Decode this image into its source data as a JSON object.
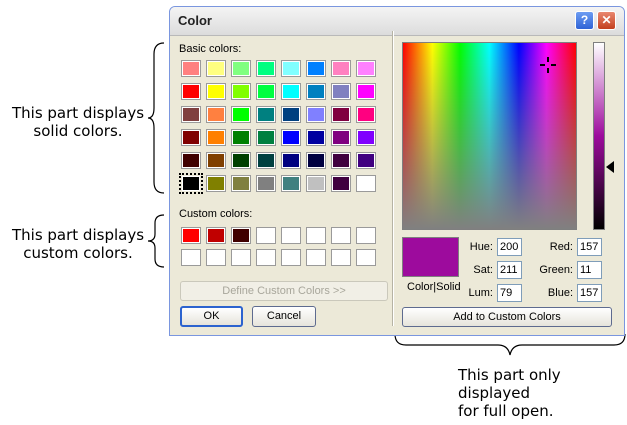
{
  "annotations": {
    "solid_line1": "This part displays",
    "solid_line2": "solid colors.",
    "custom_line1": "This part displays",
    "custom_line2": "custom colors.",
    "full_line1": "This part only",
    "full_line2": "displayed",
    "full_line3": "for full open."
  },
  "dialog": {
    "title": "Color",
    "help_glyph": "?",
    "close_glyph": "✕"
  },
  "basic": {
    "label": "Basic colors:",
    "colors": [
      [
        "#ff8080",
        "#ffff80",
        "#80ff80",
        "#00ff80",
        "#80ffff",
        "#0080ff",
        "#ff80c0",
        "#ff80ff"
      ],
      [
        "#ff0000",
        "#ffff00",
        "#80ff00",
        "#00ff40",
        "#00ffff",
        "#0080c0",
        "#8080c0",
        "#ff00ff"
      ],
      [
        "#804040",
        "#ff8040",
        "#00ff00",
        "#008080",
        "#004080",
        "#8080ff",
        "#800040",
        "#ff0080"
      ],
      [
        "#800000",
        "#ff8000",
        "#008000",
        "#008040",
        "#0000ff",
        "#0000a0",
        "#800080",
        "#8000ff"
      ],
      [
        "#400000",
        "#804000",
        "#004000",
        "#004040",
        "#000080",
        "#000040",
        "#400040",
        "#400080"
      ],
      [
        "#000000",
        "#808000",
        "#808040",
        "#808080",
        "#408080",
        "#c0c0c0",
        "#400040",
        "#ffffff"
      ]
    ]
  },
  "custom": {
    "label": "Custom colors:",
    "colors": [
      [
        "#ff0000",
        "#c00000",
        "#400000",
        "#ffffff",
        "#ffffff",
        "#ffffff",
        "#ffffff",
        "#ffffff"
      ],
      [
        "#ffffff",
        "#ffffff",
        "#ffffff",
        "#ffffff",
        "#ffffff",
        "#ffffff",
        "#ffffff",
        "#ffffff"
      ]
    ]
  },
  "buttons": {
    "define_custom": "Define Custom Colors >>",
    "ok": "OK",
    "cancel": "Cancel",
    "add_custom": "Add to Custom Colors"
  },
  "preview": {
    "label": "Color|Solid",
    "color": "#9d0b9d"
  },
  "fields": {
    "hue_label": "Hue:",
    "hue": "200",
    "sat_label": "Sat:",
    "sat": "211",
    "lum_label": "Lum:",
    "lum": "79",
    "red_label": "Red:",
    "red": "157",
    "green_label": "Green:",
    "green": "11",
    "blue_label": "Blue:",
    "blue": "157"
  }
}
